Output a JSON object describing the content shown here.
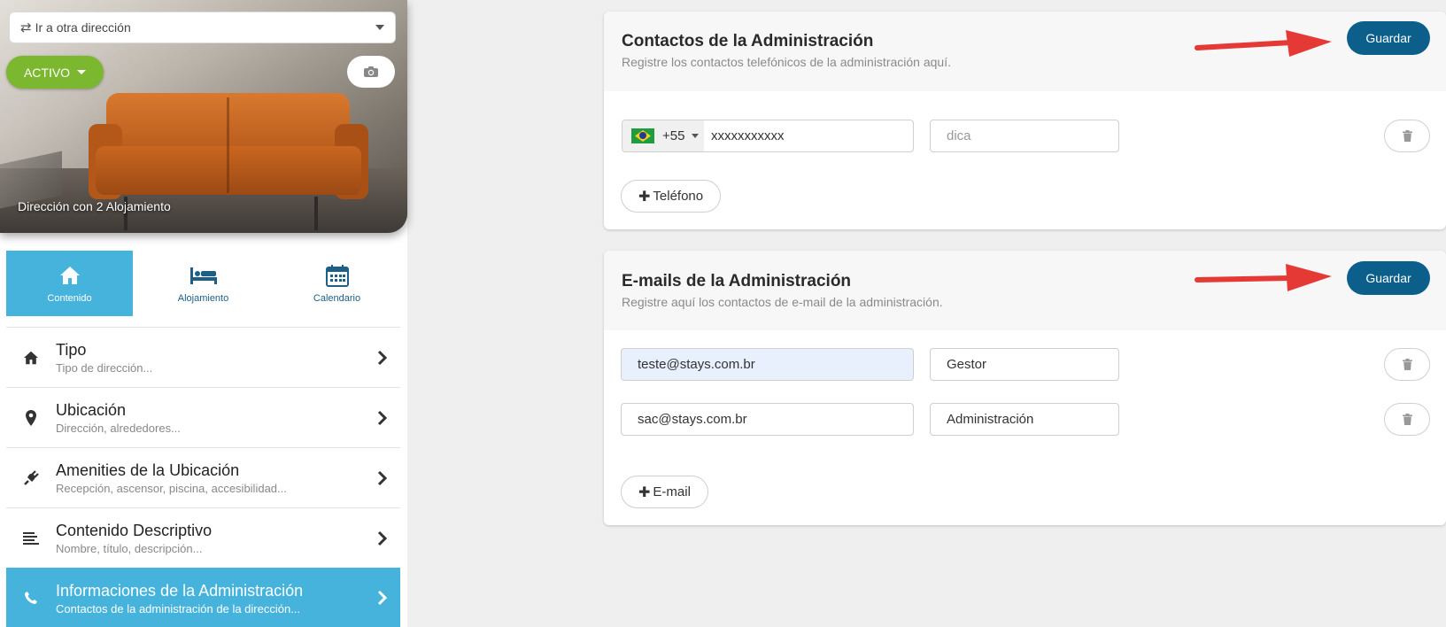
{
  "sidebar": {
    "address_select": {
      "label": "Ir a otra dirección",
      "icon": "swap-icon"
    },
    "status": {
      "label": "ACTIVO",
      "color": "#7cb82f"
    },
    "camera_icon": "camera-icon",
    "hero_caption": "Dirección con 2 Alojamiento",
    "tabs": [
      {
        "label": "Contenido",
        "icon": "home-icon",
        "active": true
      },
      {
        "label": "Alojamiento",
        "icon": "bed-icon",
        "active": false
      },
      {
        "label": "Calendario",
        "icon": "calendar-icon",
        "active": false
      }
    ],
    "menu": [
      {
        "title": "Tipo",
        "subtitle": "Tipo de dirección...",
        "icon": "home-icon"
      },
      {
        "title": "Ubicación",
        "subtitle": "Dirección, alrededores...",
        "icon": "map-pin-icon"
      },
      {
        "title": "Amenities de la Ubicación",
        "subtitle": "Recepción, ascensor, piscina, accesibilidad...",
        "icon": "plug-icon"
      },
      {
        "title": "Contenido Descriptivo",
        "subtitle": "Nombre, título, descripción...",
        "icon": "text-lines-icon"
      },
      {
        "title": "Informaciones de la Administración",
        "subtitle": "Contactos de la administración de la dirección...",
        "icon": "phone-icon",
        "active": true
      }
    ],
    "accent_color": "#45b3dc"
  },
  "phones_card": {
    "title": "Contactos de la Administración",
    "description": "Registre los contactos telefónicos de la administración aquí.",
    "save_label": "Guardar",
    "rows": [
      {
        "country_code": "+55",
        "flag": "brazil-flag-icon",
        "number": "xxxxxxxxxxx",
        "hint_placeholder": "dica"
      }
    ],
    "add_label": "Teléfono"
  },
  "emails_card": {
    "title": "E-mails de la Administración",
    "description": "Registre aquí los contactos de e-mail de la administración.",
    "save_label": "Guardar",
    "rows": [
      {
        "email": "teste@stays.com.br",
        "role": "Gestor"
      },
      {
        "email": "sac@stays.com.br",
        "role": "Administración"
      }
    ],
    "add_label": "E-mail"
  },
  "colors": {
    "save_button": "#0d5f8b",
    "annotation_arrow": "#e53935"
  }
}
